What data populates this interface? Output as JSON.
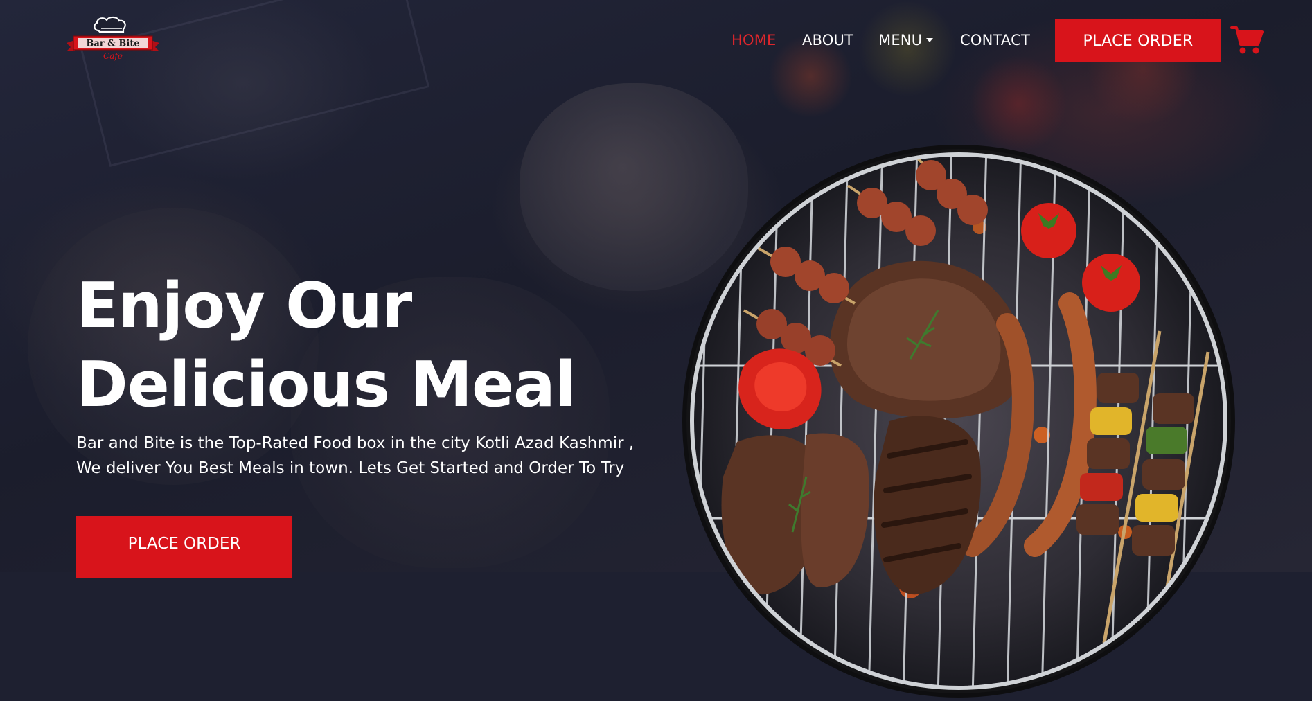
{
  "brand": {
    "logo_text": "Bar & Bite",
    "logo_subtext": "Cafe"
  },
  "nav": {
    "items": [
      {
        "label": "HOME",
        "active": true
      },
      {
        "label": "ABOUT",
        "active": false
      },
      {
        "label": "MENU",
        "active": false,
        "dropdown": true
      },
      {
        "label": "CONTACT",
        "active": false
      }
    ],
    "cta_label": "PLACE ORDER",
    "cart_icon": "shopping-cart-icon"
  },
  "hero": {
    "title_line1": "Enjoy Our",
    "title_line2": "Delicious Meal",
    "text": "Bar and Bite is the Top-Rated Food box in the city Kotli Azad Kashmir , We deliver You Best Meals in town. Lets Get Started and Order To Try",
    "button_label": "PLACE ORDER",
    "image": "bbq-grill-image"
  },
  "colors": {
    "accent": "#d8141b",
    "active_link": "#e0262c",
    "background": "#1e2030",
    "text": "#ffffff"
  }
}
